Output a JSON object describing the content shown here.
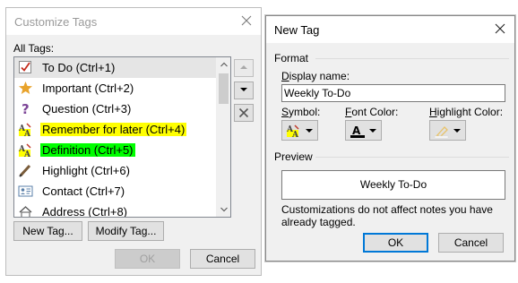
{
  "customize": {
    "title": "Customize Tags",
    "all_tags_label": "All Tags:",
    "tags": [
      {
        "label": "To Do (Ctrl+1)",
        "icon": "checkbox-checked-icon",
        "highlight": "",
        "selected": true
      },
      {
        "label": "Important (Ctrl+2)",
        "icon": "star-icon",
        "highlight": "",
        "selected": false
      },
      {
        "label": "Question (Ctrl+3)",
        "icon": "question-mark-icon",
        "highlight": "",
        "selected": false
      },
      {
        "label": "Remember for later (Ctrl+4)",
        "icon": "highlighter-text-icon",
        "highlight": "#ffff00",
        "selected": false
      },
      {
        "label": "Definition (Ctrl+5)",
        "icon": "highlighter-text-icon",
        "highlight": "#00ff00",
        "selected": false
      },
      {
        "label": "Highlight (Ctrl+6)",
        "icon": "pen-icon",
        "highlight": "",
        "selected": false
      },
      {
        "label": "Contact (Ctrl+7)",
        "icon": "contact-card-icon",
        "highlight": "",
        "selected": false
      },
      {
        "label": "Address (Ctrl+8)",
        "icon": "house-icon",
        "highlight": "",
        "selected": false
      }
    ],
    "new_tag_button": "New Tag...",
    "modify_tag_button": "Modify Tag...",
    "ok_button": "OK",
    "cancel_button": "Cancel"
  },
  "new_tag": {
    "title": "New Tag",
    "format_label": "Format",
    "display_name_label": "Display name:",
    "display_name_value": "Weekly To-Do",
    "symbol_label": "Symbol:",
    "font_color_label": "Font Color:",
    "highlight_color_label": "Highlight Color:",
    "preview_label": "Preview",
    "preview_text": "Weekly To-Do",
    "note": "Customizations do not affect notes you have already tagged.",
    "ok_button": "OK",
    "cancel_button": "Cancel"
  },
  "colors": {
    "accent": "#0078d7",
    "selection": "#e5e5e5",
    "checkbox_red": "#c42b1c",
    "star_gold": "#e8a32c",
    "question_purple": "#7d4698"
  }
}
